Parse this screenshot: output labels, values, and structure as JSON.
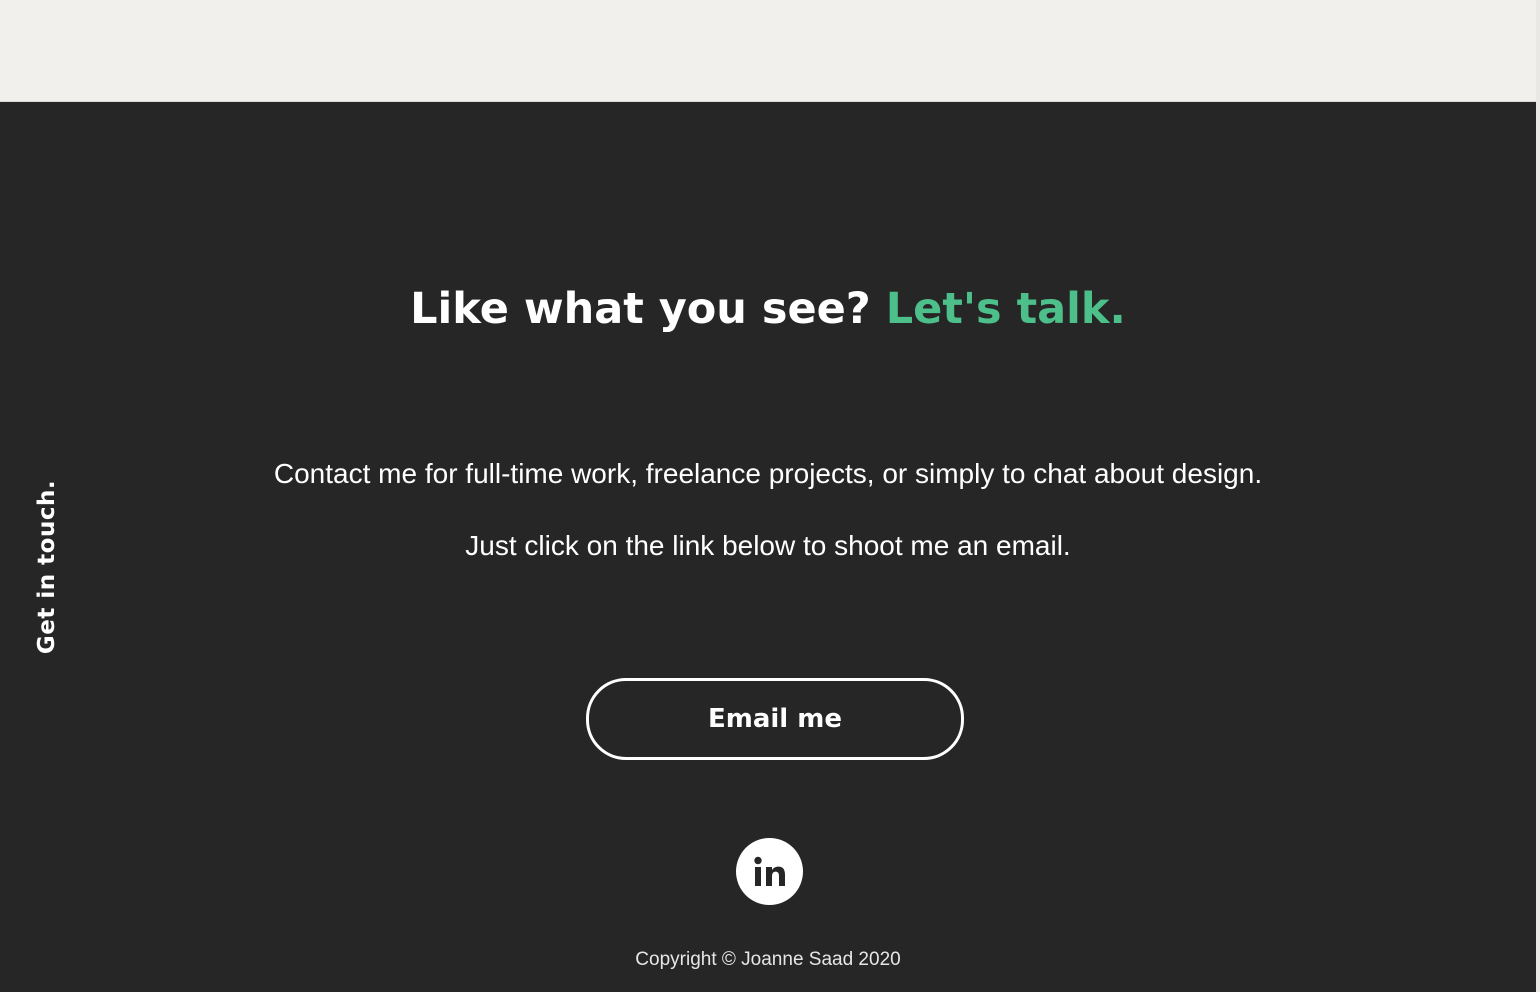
{
  "side_label": "Get in touch.",
  "headline": {
    "main": "Like what you see?",
    "accent": "Let's talk."
  },
  "body": {
    "line1": "Contact me for full-time work, freelance projects, or simply to chat about design.",
    "line2": "Just click on the link below to shoot me an email."
  },
  "cta": {
    "label": "Email me"
  },
  "social": {
    "linkedin_icon": "linkedin-icon"
  },
  "footer": {
    "copyright": "Copyright © Joanne Saad 2020"
  },
  "colors": {
    "background_dark": "#262626",
    "top_band": "#f1f0ec",
    "accent_green": "#4dbf8a",
    "text": "#ffffff"
  }
}
